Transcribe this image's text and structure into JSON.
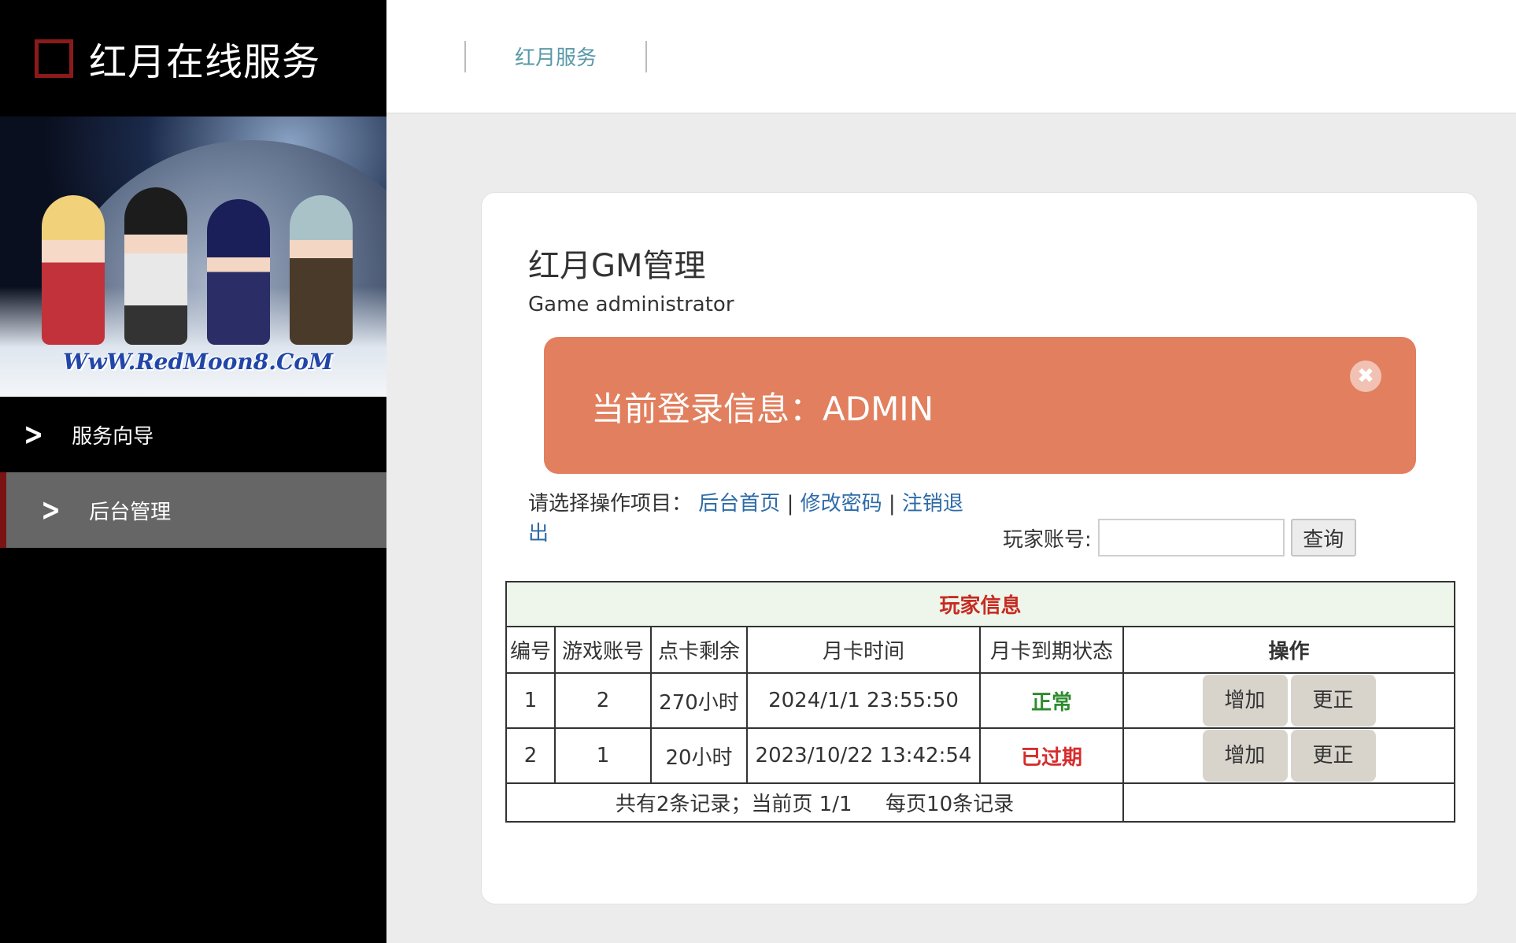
{
  "brand": {
    "title": "红月在线服务"
  },
  "banner": {
    "text": "WwW.RedMoon8.CoM"
  },
  "sidebar": {
    "items": [
      {
        "label": "服务向导"
      },
      {
        "label": "后台管理"
      }
    ]
  },
  "topbar": {
    "link": "红月服务"
  },
  "panel": {
    "title": "红月GM管理",
    "subtitle": "Game administrator",
    "alert": "当前登录信息：ADMIN",
    "alert_close": "✖",
    "ops_label": "请选择操作项目：",
    "ops_links": [
      "后台首页",
      "修改密码",
      "注销退出"
    ],
    "ops_sep": "|",
    "search_label": "玩家账号:",
    "search_value": "",
    "search_button": "查询"
  },
  "table": {
    "caption": "玩家信息",
    "headers": [
      "编号",
      "游戏账号",
      "点卡剩余",
      "月卡时间",
      "月卡到期状态",
      "操作"
    ],
    "rows": [
      {
        "id": "1",
        "account": "2",
        "points": "270小时",
        "time": "2024/1/1 23:55:50",
        "status": "正常",
        "add": "增加",
        "edit": "更正"
      },
      {
        "id": "2",
        "account": "1",
        "points": "20小时",
        "time": "2023/10/22 13:42:54",
        "status": "已过期",
        "add": "增加",
        "edit": "更正"
      }
    ],
    "footer": "共有2条记录；当前页 1/1 　 每页10条记录"
  },
  "colors": {
    "accent_red": "#8b1a1a",
    "alert": "#e27f5e",
    "ok": "#2e8b2e",
    "expired": "#d62d2d",
    "link": "#2d6aa8"
  }
}
